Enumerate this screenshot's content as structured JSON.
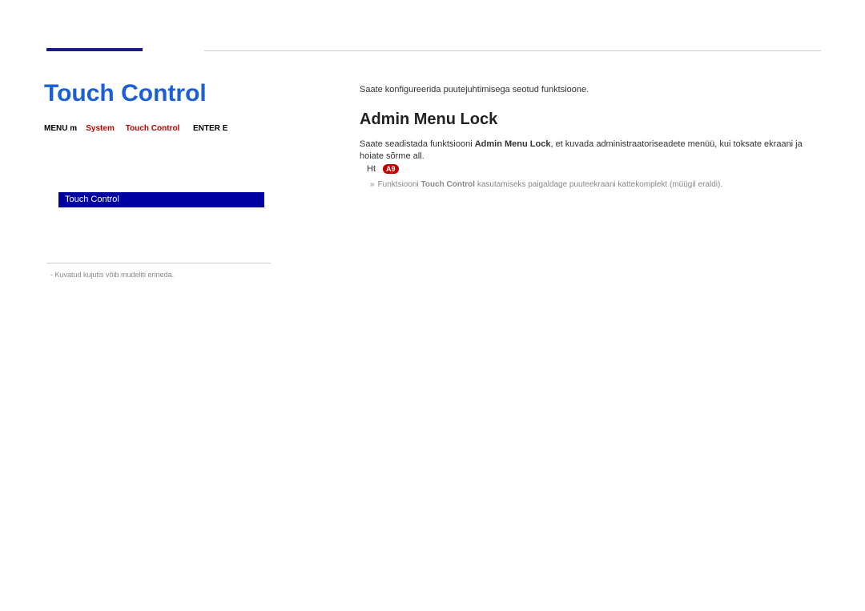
{
  "main_title": "Touch Control",
  "menu_path": {
    "menu": "MENU",
    "arrow": "m",
    "system": "System",
    "touch_control": "Touch Control",
    "enter": "ENTER",
    "e": "E"
  },
  "button_label": "Touch Control",
  "footnote": "-   Kuvatud kujutis võib mudeliti erineda.",
  "intro": "Saate konfigureerida puutejuhtimisega seotud funktsioone.",
  "section_title": "Admin Menu Lock",
  "section_body_pre": "Saate seadistada funktsiooni ",
  "section_body_bold": "Admin Menu Lock",
  "section_body_post": ", et kuvada administraatoriseadete menüü, kui toksate ekraani ja hoiate sõrme all.",
  "hint_label": "Ht",
  "hint_badge": "A9",
  "hint_arrow": "»",
  "hint_text_pre": "Funktsiooni ",
  "hint_text_bold": "Touch Control",
  "hint_text_post": " kasutamiseks paigaldage puuteekraani kattekomplekt (müügil eraldi)."
}
